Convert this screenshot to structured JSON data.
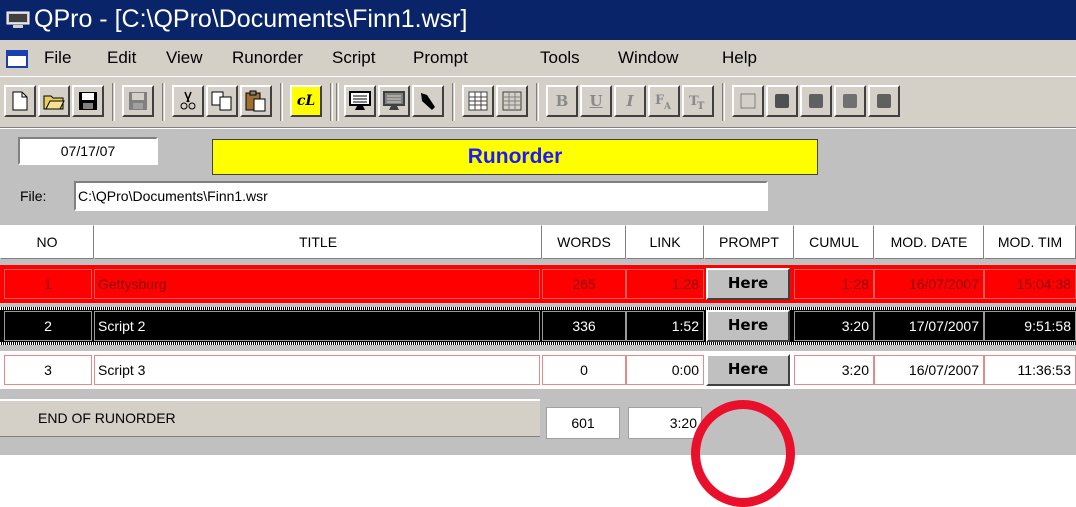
{
  "window": {
    "title": "QPro - [C:\\QPro\\Documents\\Finn1.wsr]"
  },
  "menu": {
    "items": [
      "File",
      "Edit",
      "View",
      "Runorder",
      "Script",
      "Prompt",
      "Tools",
      "Window",
      "Help"
    ]
  },
  "toolbar": {
    "buttons": [
      "new-icon",
      "open-icon",
      "save-icon",
      "save-disabled-icon",
      "cut-icon",
      "copy-icon",
      "paste-icon",
      "cl-icon",
      "monitor-icon",
      "monitor-alt-icon",
      "arrow-icon",
      "grid-icon",
      "grid-alt-icon",
      "bold-icon",
      "underline-icon",
      "italic-icon",
      "font-size-icon",
      "font-icon",
      "box-icon",
      "color-block-icon"
    ],
    "bold_label": "B",
    "underline_label": "U",
    "italic_label": "I",
    "cl_label": "cL"
  },
  "runorder": {
    "date": "07/17/07",
    "banner": "Runorder",
    "file_label": "File:",
    "file_path": "C:\\QPro\\Documents\\Finn1.wsr",
    "columns": [
      "NO",
      "TITLE",
      "WORDS",
      "LINK",
      "PROMPT",
      "CUMUL",
      "MOD. DATE",
      "MOD. TIM"
    ],
    "rows": [
      {
        "no": "1",
        "title": "Gettysburg",
        "words": "265",
        "link": "1:28",
        "prompt": "Here",
        "cumul": "1:28",
        "mod_date": "16/07/2007",
        "mod_time": "15:04:38"
      },
      {
        "no": "2",
        "title": "Script 2",
        "words": "336",
        "link": "1:52",
        "prompt": "Here",
        "cumul": "3:20",
        "mod_date": "17/07/2007",
        "mod_time": "9:51:58"
      },
      {
        "no": "3",
        "title": "Script 3",
        "words": "0",
        "link": "0:00",
        "prompt": "Here",
        "cumul": "3:20",
        "mod_date": "16/07/2007",
        "mod_time": "11:36:53"
      }
    ],
    "end_label": "END OF RUNORDER",
    "end_words": "601",
    "end_link": "3:20"
  },
  "colors": {
    "selected_row": "#000000",
    "red_row": "#ff0000",
    "banner": "#ffff00",
    "banner_text": "#1a1aff",
    "annotation_circle": "#e8102a"
  }
}
